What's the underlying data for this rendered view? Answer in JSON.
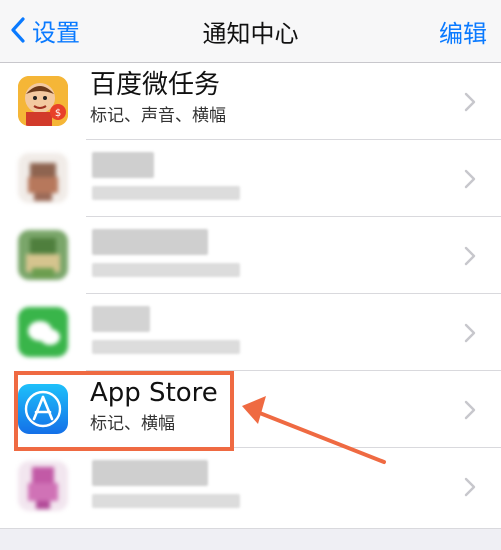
{
  "nav": {
    "back_label": "设置",
    "title": "通知中心",
    "edit_label": "编辑"
  },
  "rows": [
    {
      "title": "百度微任务",
      "subtitle": "标记、声音、横幅",
      "icon": "baidu-task-icon",
      "obscured": false
    },
    {
      "title": "",
      "subtitle": "",
      "icon": "obscured-app-icon",
      "obscured": true
    },
    {
      "title": "",
      "subtitle": "",
      "icon": "obscured-app-icon",
      "obscured": true
    },
    {
      "title": "",
      "subtitle": "",
      "icon": "wechat-icon",
      "obscured": true
    },
    {
      "title": "App Store",
      "subtitle": "标记、横幅",
      "icon": "app-store-icon",
      "obscured": false
    },
    {
      "title": "",
      "subtitle": "",
      "icon": "obscured-app-icon",
      "obscured": true
    }
  ],
  "colors": {
    "accent": "#0a7aff",
    "highlight": "#ef6a42"
  }
}
